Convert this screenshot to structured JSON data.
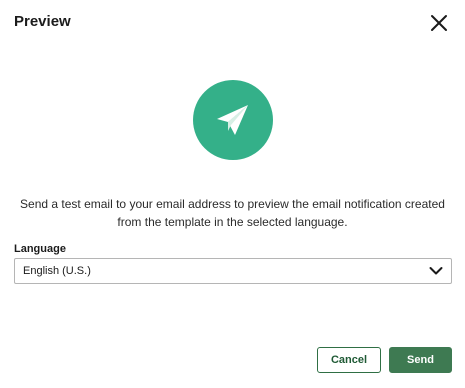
{
  "dialog": {
    "title": "Preview",
    "close_icon": "close-icon"
  },
  "hero": {
    "icon": "paper-plane-icon",
    "circle_color": "#34b089"
  },
  "description": "Send a test email to your email address to preview the email notification created from the template in the selected language.",
  "language": {
    "label": "Language",
    "selected": "English (U.S.)",
    "icon": "chevron-down-icon"
  },
  "footer": {
    "cancel_label": "Cancel",
    "send_label": "Send",
    "accent_color": "#3e7a52"
  }
}
